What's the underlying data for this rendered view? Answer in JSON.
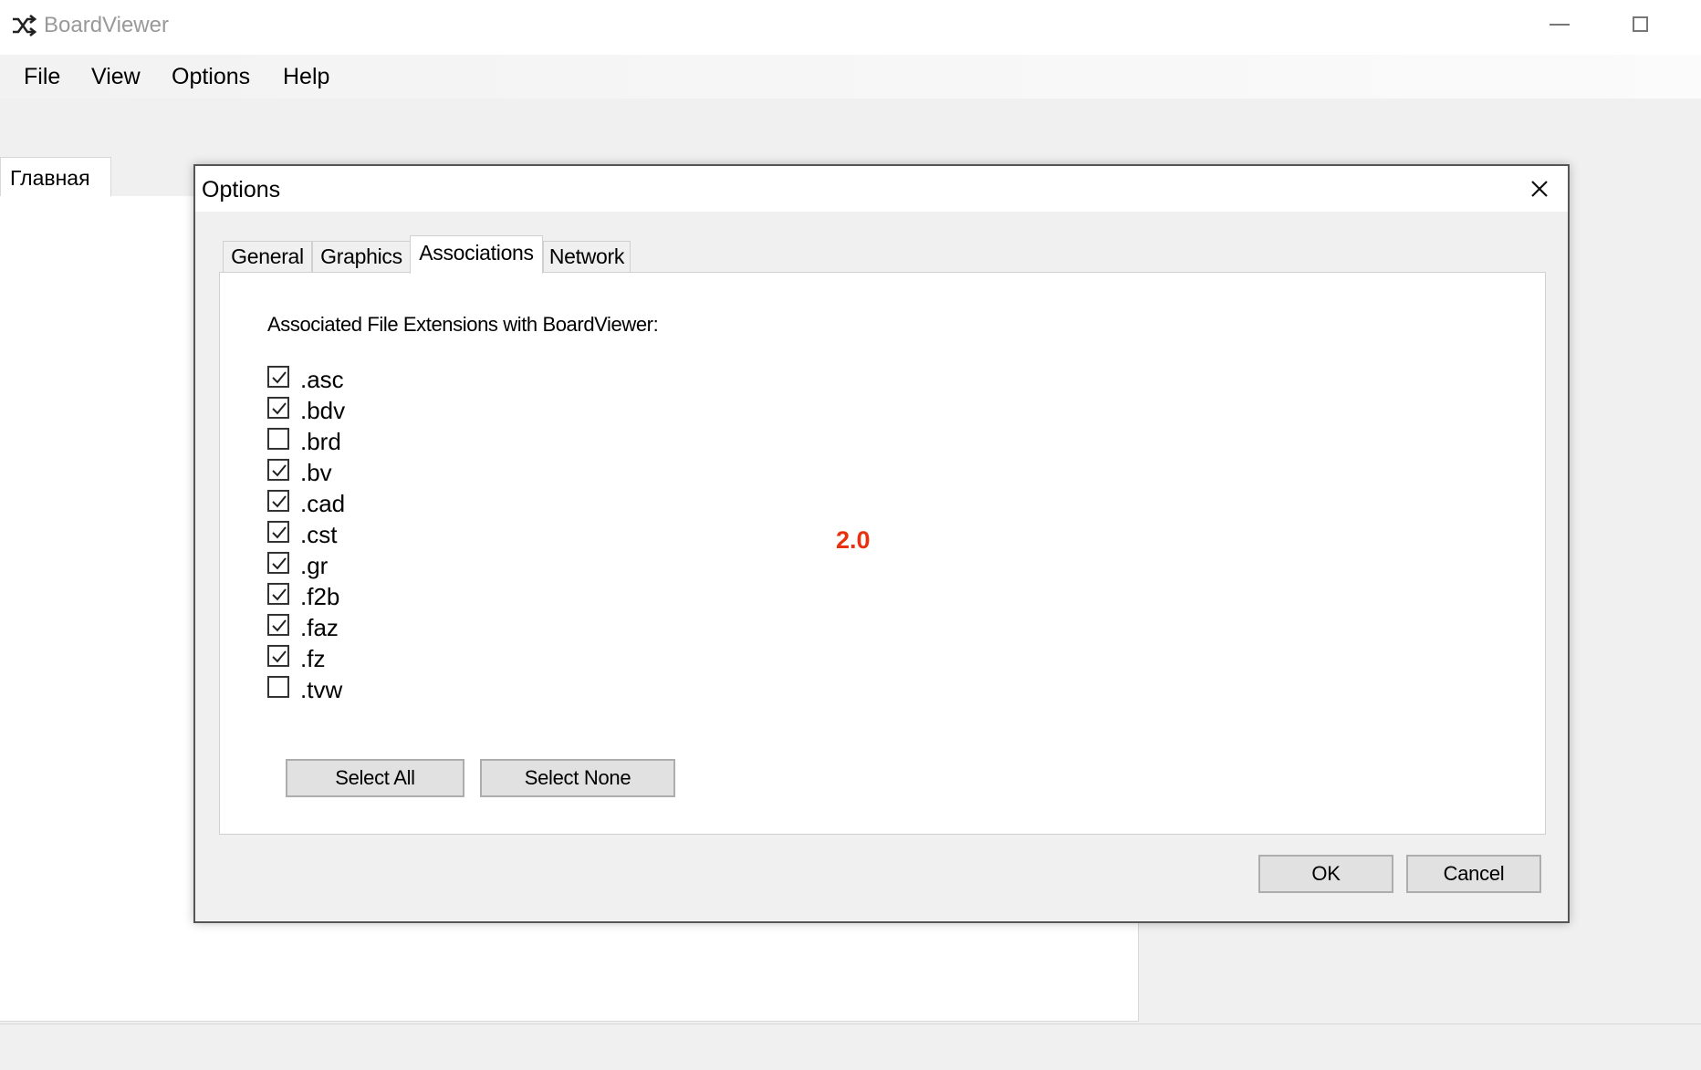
{
  "window": {
    "title": "BoardViewer",
    "icon": "shuffle-icon"
  },
  "menu": {
    "items": [
      "File",
      "View",
      "Options",
      "Help"
    ]
  },
  "main": {
    "tab_label": "Главная"
  },
  "dialog": {
    "title": "Options",
    "tabs": [
      "General",
      "Graphics",
      "Associations",
      "Network"
    ],
    "active_tab": "Associations",
    "associations": {
      "label": "Associated File Extensions with BoardViewer:",
      "extensions": [
        {
          "ext": ".asc",
          "checked": true
        },
        {
          "ext": ".bdv",
          "checked": true
        },
        {
          "ext": ".brd",
          "checked": false
        },
        {
          "ext": ".bv",
          "checked": true
        },
        {
          "ext": ".cad",
          "checked": true
        },
        {
          "ext": ".cst",
          "checked": true
        },
        {
          "ext": ".gr",
          "checked": true
        },
        {
          "ext": ".f2b",
          "checked": true
        },
        {
          "ext": ".faz",
          "checked": true
        },
        {
          "ext": ".fz",
          "checked": true
        },
        {
          "ext": ".tvw",
          "checked": false
        }
      ],
      "select_all_label": "Select All",
      "select_none_label": "Select None",
      "version_text": "2.0",
      "version_color": "#e8310e"
    },
    "ok_label": "OK",
    "cancel_label": "Cancel"
  }
}
